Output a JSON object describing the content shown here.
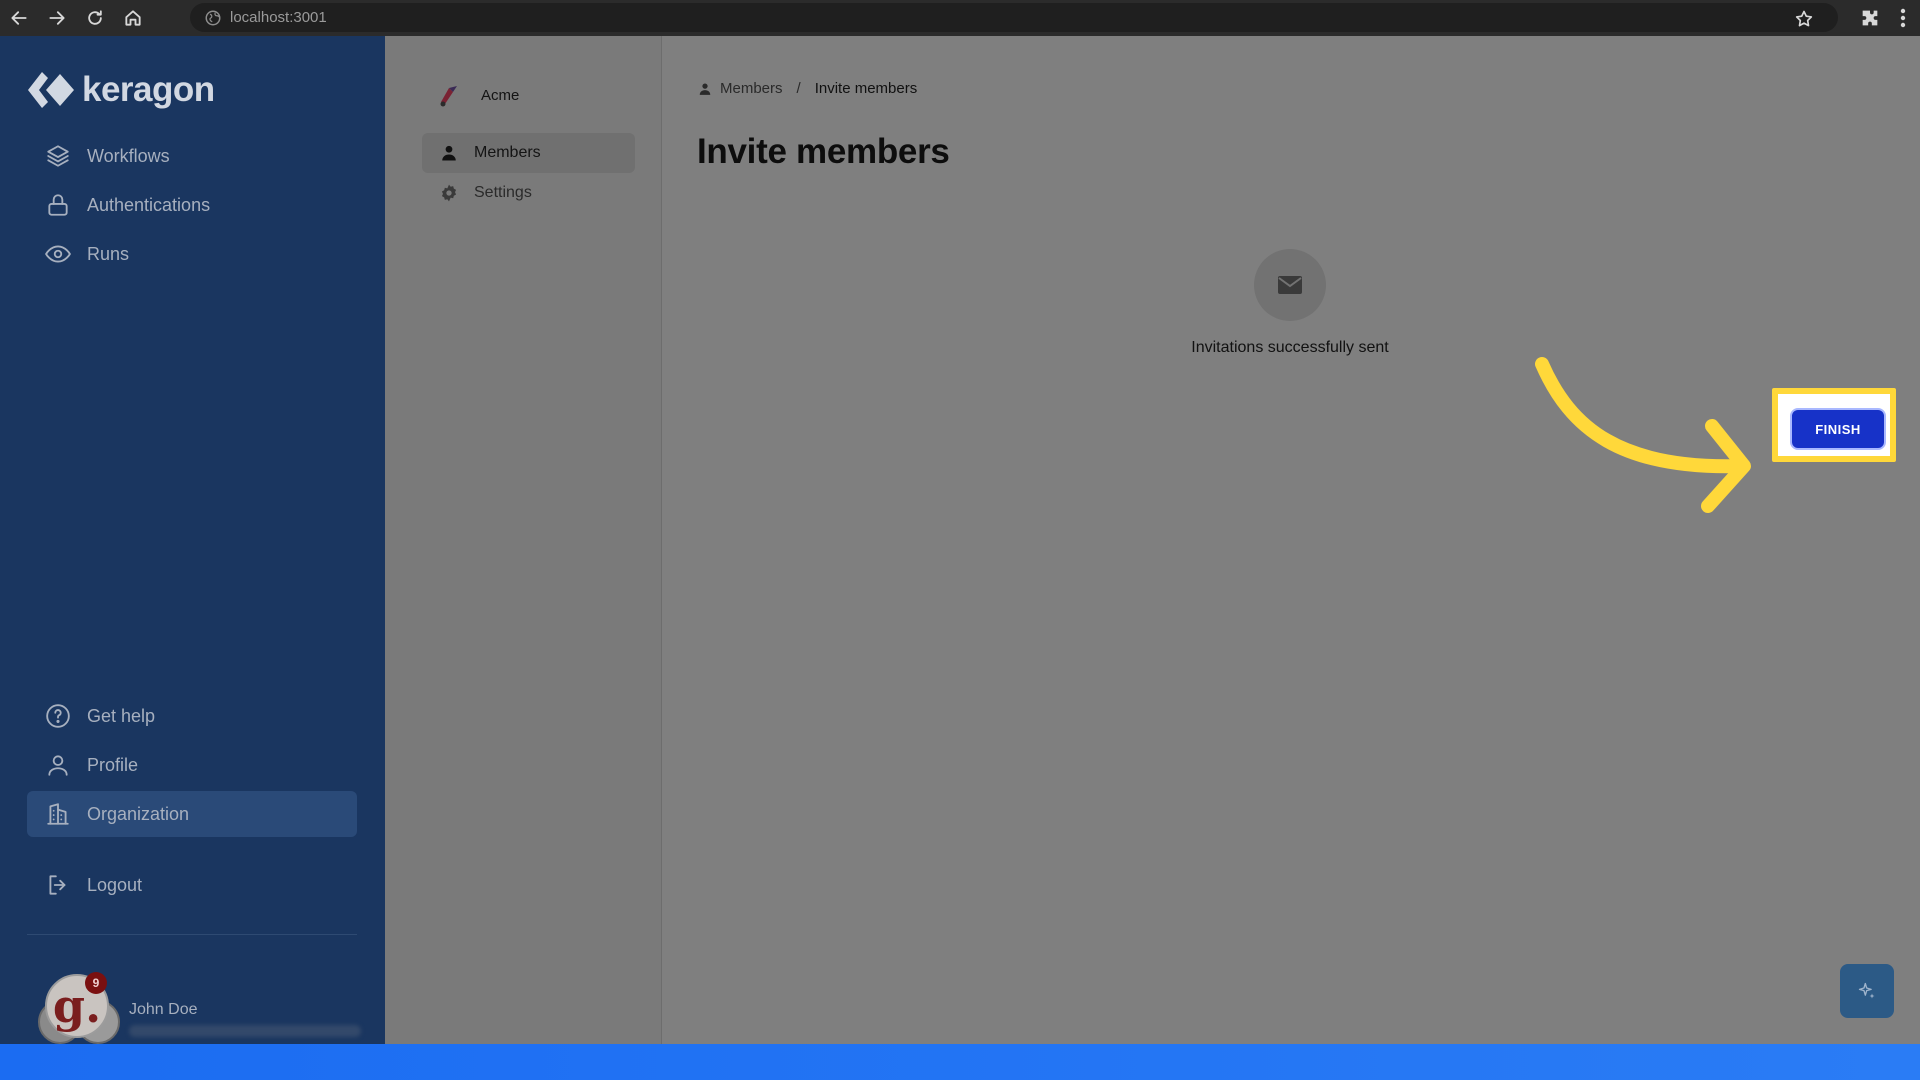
{
  "browser": {
    "url": "localhost:3001"
  },
  "sidebar": {
    "brand": "keragon",
    "items": [
      {
        "label": "Workflows",
        "icon": "layers-icon"
      },
      {
        "label": "Authentications",
        "icon": "lock-icon"
      },
      {
        "label": "Runs",
        "icon": "eye-icon"
      }
    ],
    "bottom_items": [
      {
        "label": "Get help",
        "icon": "help-circle-icon"
      },
      {
        "label": "Profile",
        "icon": "user-icon"
      },
      {
        "label": "Organization",
        "icon": "building-icon",
        "active": true
      }
    ],
    "logout": "Logout",
    "user": {
      "name": "John Doe",
      "avatar_letter": "g.",
      "notification_count": "9"
    }
  },
  "subnav": {
    "org_name": "Acme",
    "items": [
      {
        "label": "Members",
        "icon": "person-icon",
        "active": true
      },
      {
        "label": "Settings",
        "icon": "gear-icon"
      }
    ]
  },
  "main": {
    "breadcrumb": {
      "parent": "Members",
      "separator": "/",
      "current": "Invite members"
    },
    "title": "Invite members",
    "success_message": "Invitations successfully sent",
    "finish_label": "FINISH"
  },
  "colors": {
    "sidebar_bg": "#1a3660",
    "finish_button": "#1732c8",
    "highlight": "#ffd83a",
    "bottom_bar": "#1b6cf2"
  }
}
